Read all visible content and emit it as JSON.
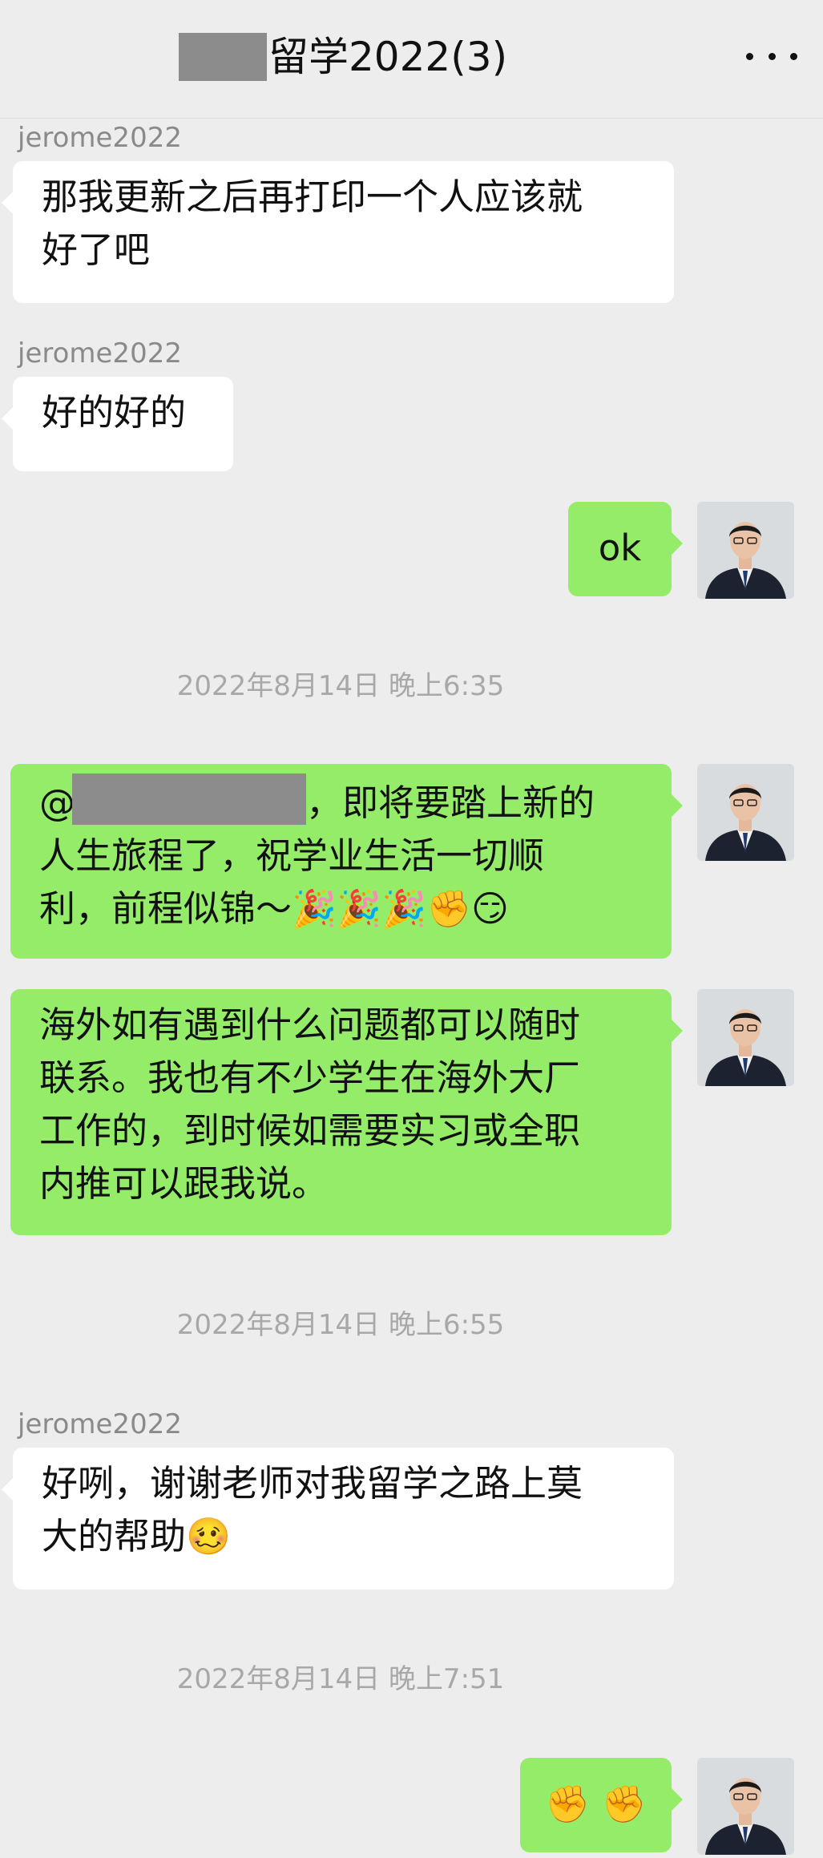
{
  "header": {
    "title_suffix": "留学2022(3)"
  },
  "messages": [
    {
      "sender": "jerome2022",
      "text": "那我更新之后再打印一个人应该就\n好了吧",
      "direction": "in"
    },
    {
      "sender": "jerome2022",
      "text": "好的好的",
      "direction": "in"
    },
    {
      "text": "ok",
      "direction": "out"
    },
    {
      "timestamp": "2022年8月14日 晚上6:35"
    },
    {
      "mention_prefix": "@",
      "text": "，即将要踏上新的\n人生旅程了，祝学业生活一切顺\n利，前程似锦～🎉🎉🎉✊😏",
      "direction": "out"
    },
    {
      "text": "海外如有遇到什么问题都可以随时\n联系。我也有不少学生在海外大厂\n工作的，到时候如需要实习或全职\n内推可以跟我说。",
      "direction": "out"
    },
    {
      "timestamp": "2022年8月14日 晚上6:55"
    },
    {
      "sender": "jerome2022",
      "text": "好咧，谢谢老师对我留学之路上莫\n大的帮助🥴",
      "direction": "in"
    },
    {
      "timestamp": "2022年8月14日 晚上7:51"
    },
    {
      "text": "✊ ✊",
      "direction": "out"
    }
  ],
  "colors": {
    "background": "#ededed",
    "incoming_bubble": "#ffffff",
    "outgoing_bubble": "#95ec69",
    "name_text": "#8a8a8a",
    "timestamp_text": "#a8a8a8"
  },
  "icons": {
    "more": "more-icon",
    "avatar": "avatar-icon"
  }
}
